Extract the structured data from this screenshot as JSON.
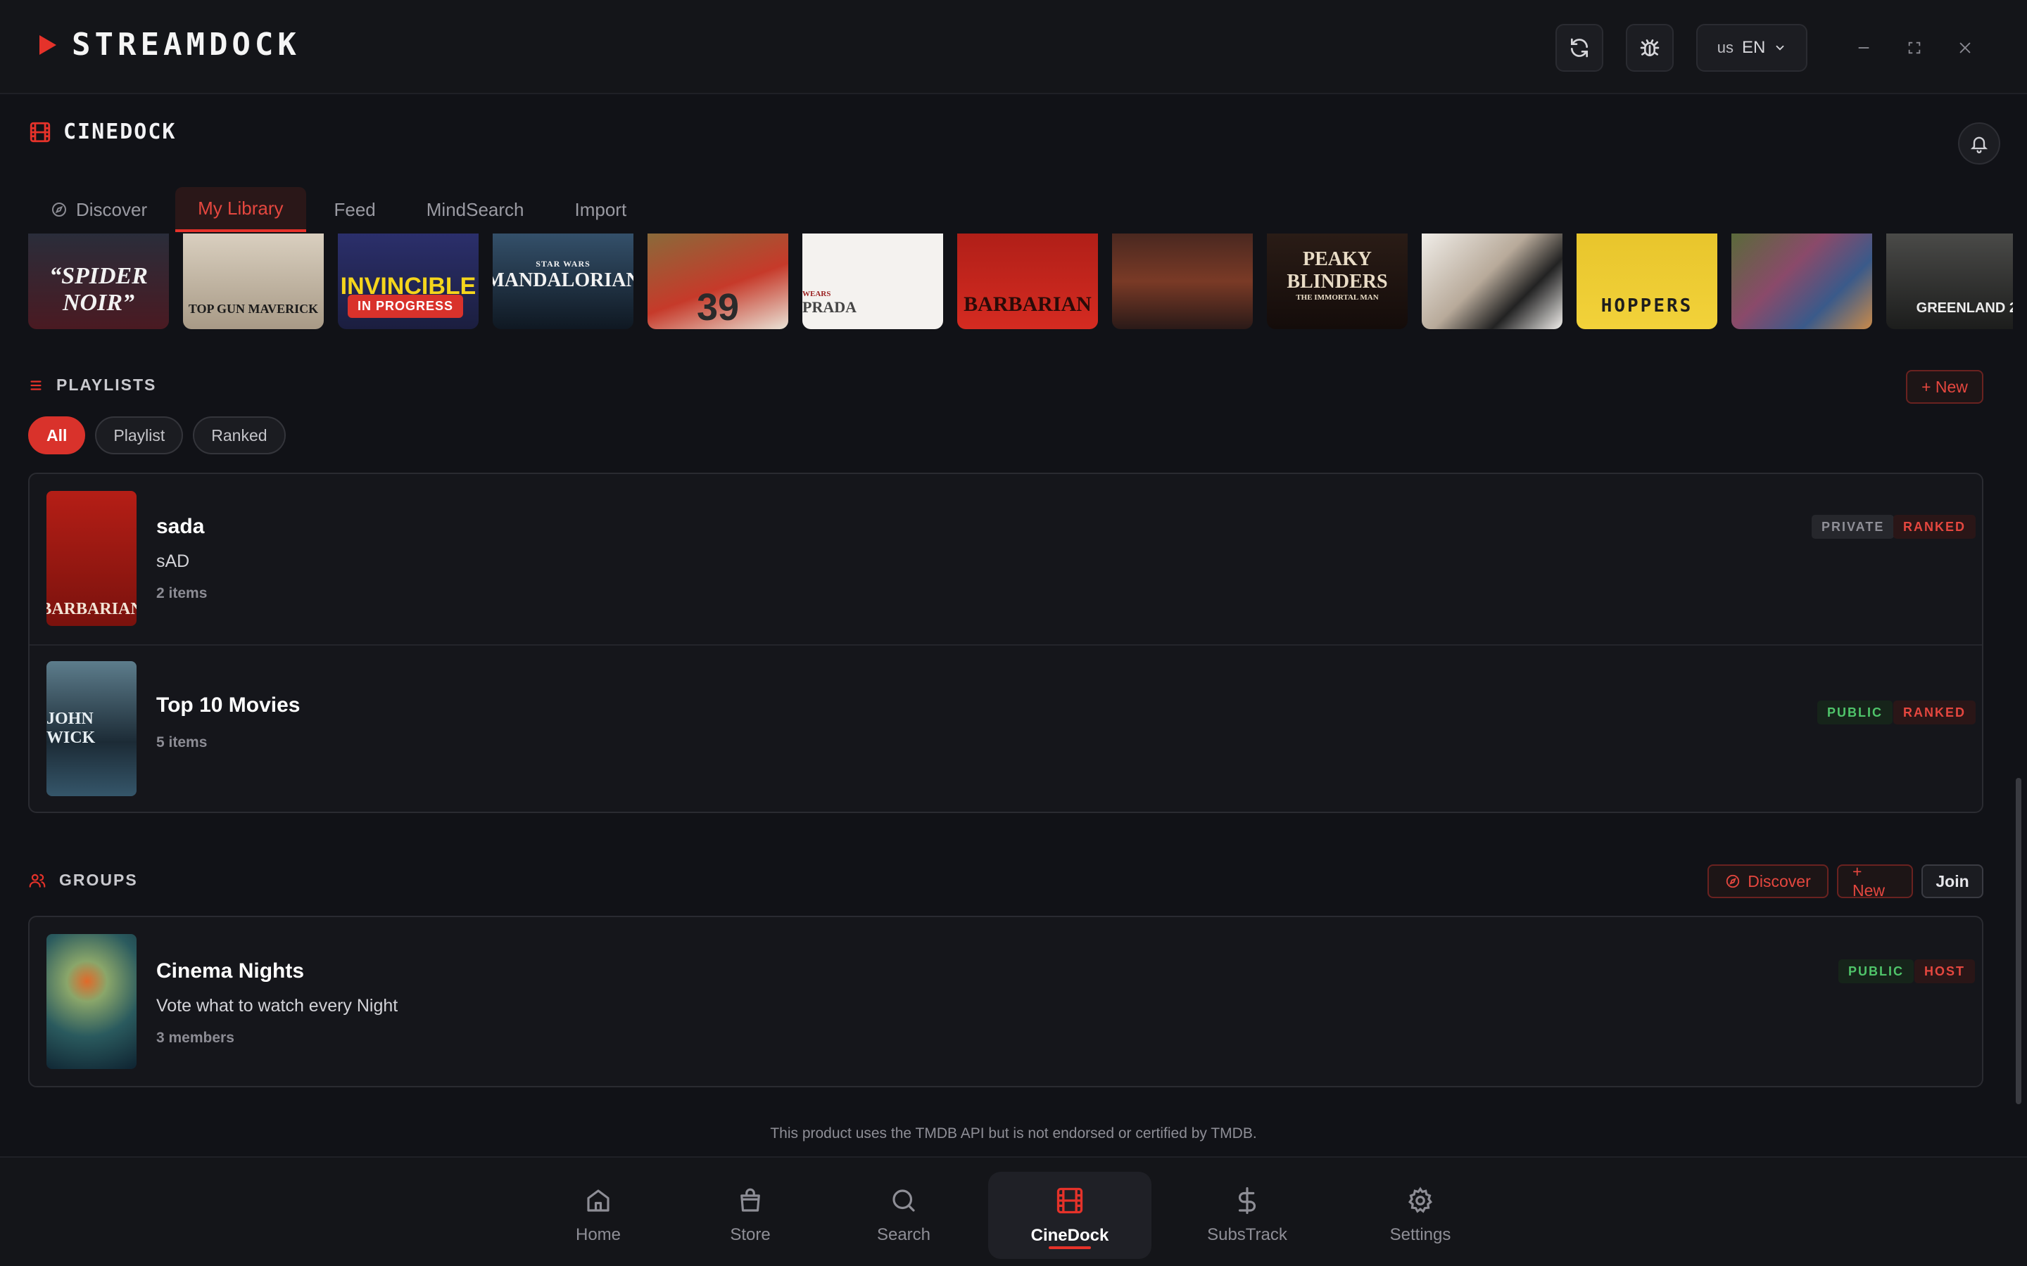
{
  "app": {
    "brand": "STREAMDOCK"
  },
  "titlebar": {
    "language_flag": "us",
    "language_code": "EN",
    "icons": [
      "refresh-icon",
      "bug-icon",
      "chevron-down-icon",
      "minimize-icon",
      "maximize-icon",
      "close-icon"
    ]
  },
  "section": {
    "title": "CINEDOCK"
  },
  "tabs": [
    {
      "label": "Discover",
      "active": false
    },
    {
      "label": "My Library",
      "active": true
    },
    {
      "label": "Feed",
      "active": false
    },
    {
      "label": "MindSearch",
      "active": false
    },
    {
      "label": "Import",
      "active": false
    }
  ],
  "posters": [
    {
      "title": "“SPIDER NOIR”"
    },
    {
      "title": "TOP GUN MAVERICK"
    },
    {
      "title": "INVINCIBLE",
      "badge": "IN PROGRESS"
    },
    {
      "title": "MANDALORIAN",
      "kicker": "STAR WARS"
    },
    {
      "title": "39"
    },
    {
      "title": "PRADA",
      "kicker": "WEARS"
    },
    {
      "title": "BARBARIAN"
    },
    {
      "title": ""
    },
    {
      "title": "PEAKY BLINDERS",
      "kicker": "THE IMMORTAL MAN"
    },
    {
      "title": ""
    },
    {
      "title": "HOPPERS"
    },
    {
      "title": ""
    },
    {
      "title": "GREENLAND 2"
    }
  ],
  "playlists": {
    "label": "PLAYLISTS",
    "new_button": "+ New",
    "filters": [
      {
        "label": "All",
        "active": true
      },
      {
        "label": "Playlist",
        "active": false
      },
      {
        "label": "Ranked",
        "active": false
      }
    ],
    "items": [
      {
        "title": "sada",
        "description": "sAD",
        "meta": "2 items",
        "thumb_text": "BARBARIAN",
        "tags": [
          "PRIVATE",
          "RANKED"
        ]
      },
      {
        "title": "Top 10 Movies",
        "description": "",
        "meta": "5 items",
        "thumb_text": "JOHN WICK",
        "tags": [
          "PUBLIC",
          "RANKED"
        ]
      }
    ]
  },
  "groups": {
    "label": "GROUPS",
    "discover_button": "Discover",
    "new_button": "+ New",
    "join_button": "Join",
    "items": [
      {
        "title": "Cinema Nights",
        "description": "Vote what to watch every Night",
        "meta": "3 members",
        "tags": [
          "PUBLIC",
          "HOST"
        ]
      }
    ]
  },
  "footnote": "This product uses the TMDB API but is not endorsed or certified by TMDB.",
  "bottom_nav": [
    {
      "label": "Home",
      "icon": "home-icon",
      "active": false
    },
    {
      "label": "Store",
      "icon": "bag-icon",
      "active": false
    },
    {
      "label": "Search",
      "icon": "search-icon",
      "active": false
    },
    {
      "label": "CineDock",
      "icon": "film-icon",
      "active": true
    },
    {
      "label": "SubsTrack",
      "icon": "dollar-icon",
      "active": false
    },
    {
      "label": "Settings",
      "icon": "gear-icon",
      "active": false
    }
  ],
  "colors": {
    "accent": "#e5322a",
    "background": "#111217",
    "public": "#4fc46a"
  }
}
